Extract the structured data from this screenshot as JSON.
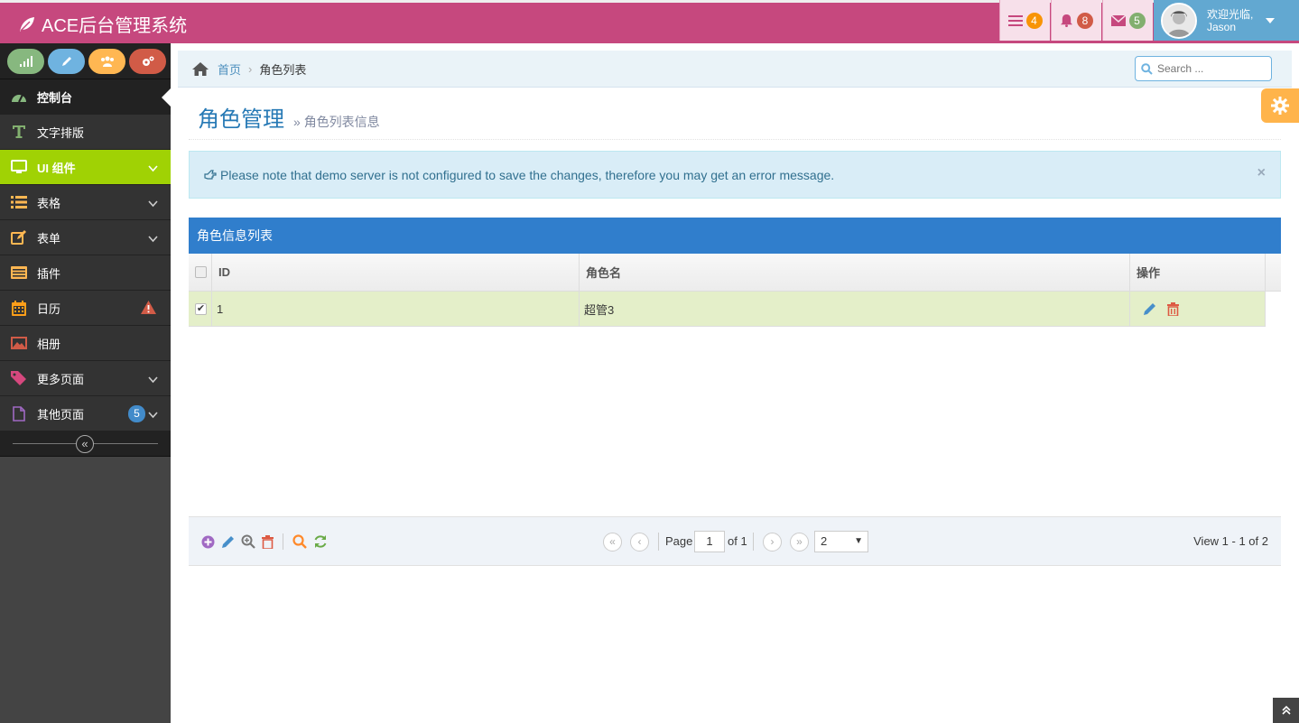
{
  "app": {
    "title": "ACE后台管理系统"
  },
  "navbar": {
    "tasks_count": "4",
    "notifications_count": "8",
    "messages_count": "5",
    "user_welcome": "欢迎光临,",
    "user_name": "Jason",
    "colors": {
      "navbar": "#c6487e",
      "user": "#62a8d1",
      "tasks_badge": "#f89406",
      "notify_badge": "#d15b47",
      "mail_badge": "#82af6f"
    }
  },
  "sidebar": {
    "shortcuts": [
      {
        "icon": "signal-icon",
        "color": "#87b87f"
      },
      {
        "icon": "pencil-icon",
        "color": "#6fb3e0"
      },
      {
        "icon": "users-icon",
        "color": "#ffb752"
      },
      {
        "icon": "cogs-icon",
        "color": "#d15b47"
      }
    ],
    "items": [
      {
        "label": "控制台",
        "icon": "tachometer-icon"
      },
      {
        "label": "文字排版",
        "icon": "text-icon"
      },
      {
        "label": "UI 组件",
        "icon": "desktop-icon"
      },
      {
        "label": "表格",
        "icon": "list-icon"
      },
      {
        "label": "表单",
        "icon": "edit-icon"
      },
      {
        "label": "插件",
        "icon": "list-alt-icon"
      },
      {
        "label": "日历",
        "icon": "calendar-icon"
      },
      {
        "label": "相册",
        "icon": "picture-icon"
      },
      {
        "label": "更多页面",
        "icon": "tag-icon"
      },
      {
        "label": "其他页面",
        "icon": "file-icon",
        "badge": "5"
      }
    ]
  },
  "breadcrumb": {
    "home": "首页",
    "current": "角色列表"
  },
  "search": {
    "placeholder": "Search ..."
  },
  "page": {
    "title": "角色管理",
    "subtitle": "角色列表信息"
  },
  "alert": {
    "message": "Please note that demo server is not configured to save the changes, therefore you may get an error message."
  },
  "grid": {
    "caption": "角色信息列表",
    "columns": [
      "ID",
      "角色名",
      "操作"
    ],
    "rows": [
      {
        "id": "1",
        "name": "超管3",
        "checked": true
      }
    ]
  },
  "pager": {
    "page_label": "Page",
    "page_value": "1",
    "of_label": "of 1",
    "rows_value": "2",
    "view_info": "View 1 - 1 of 2"
  }
}
